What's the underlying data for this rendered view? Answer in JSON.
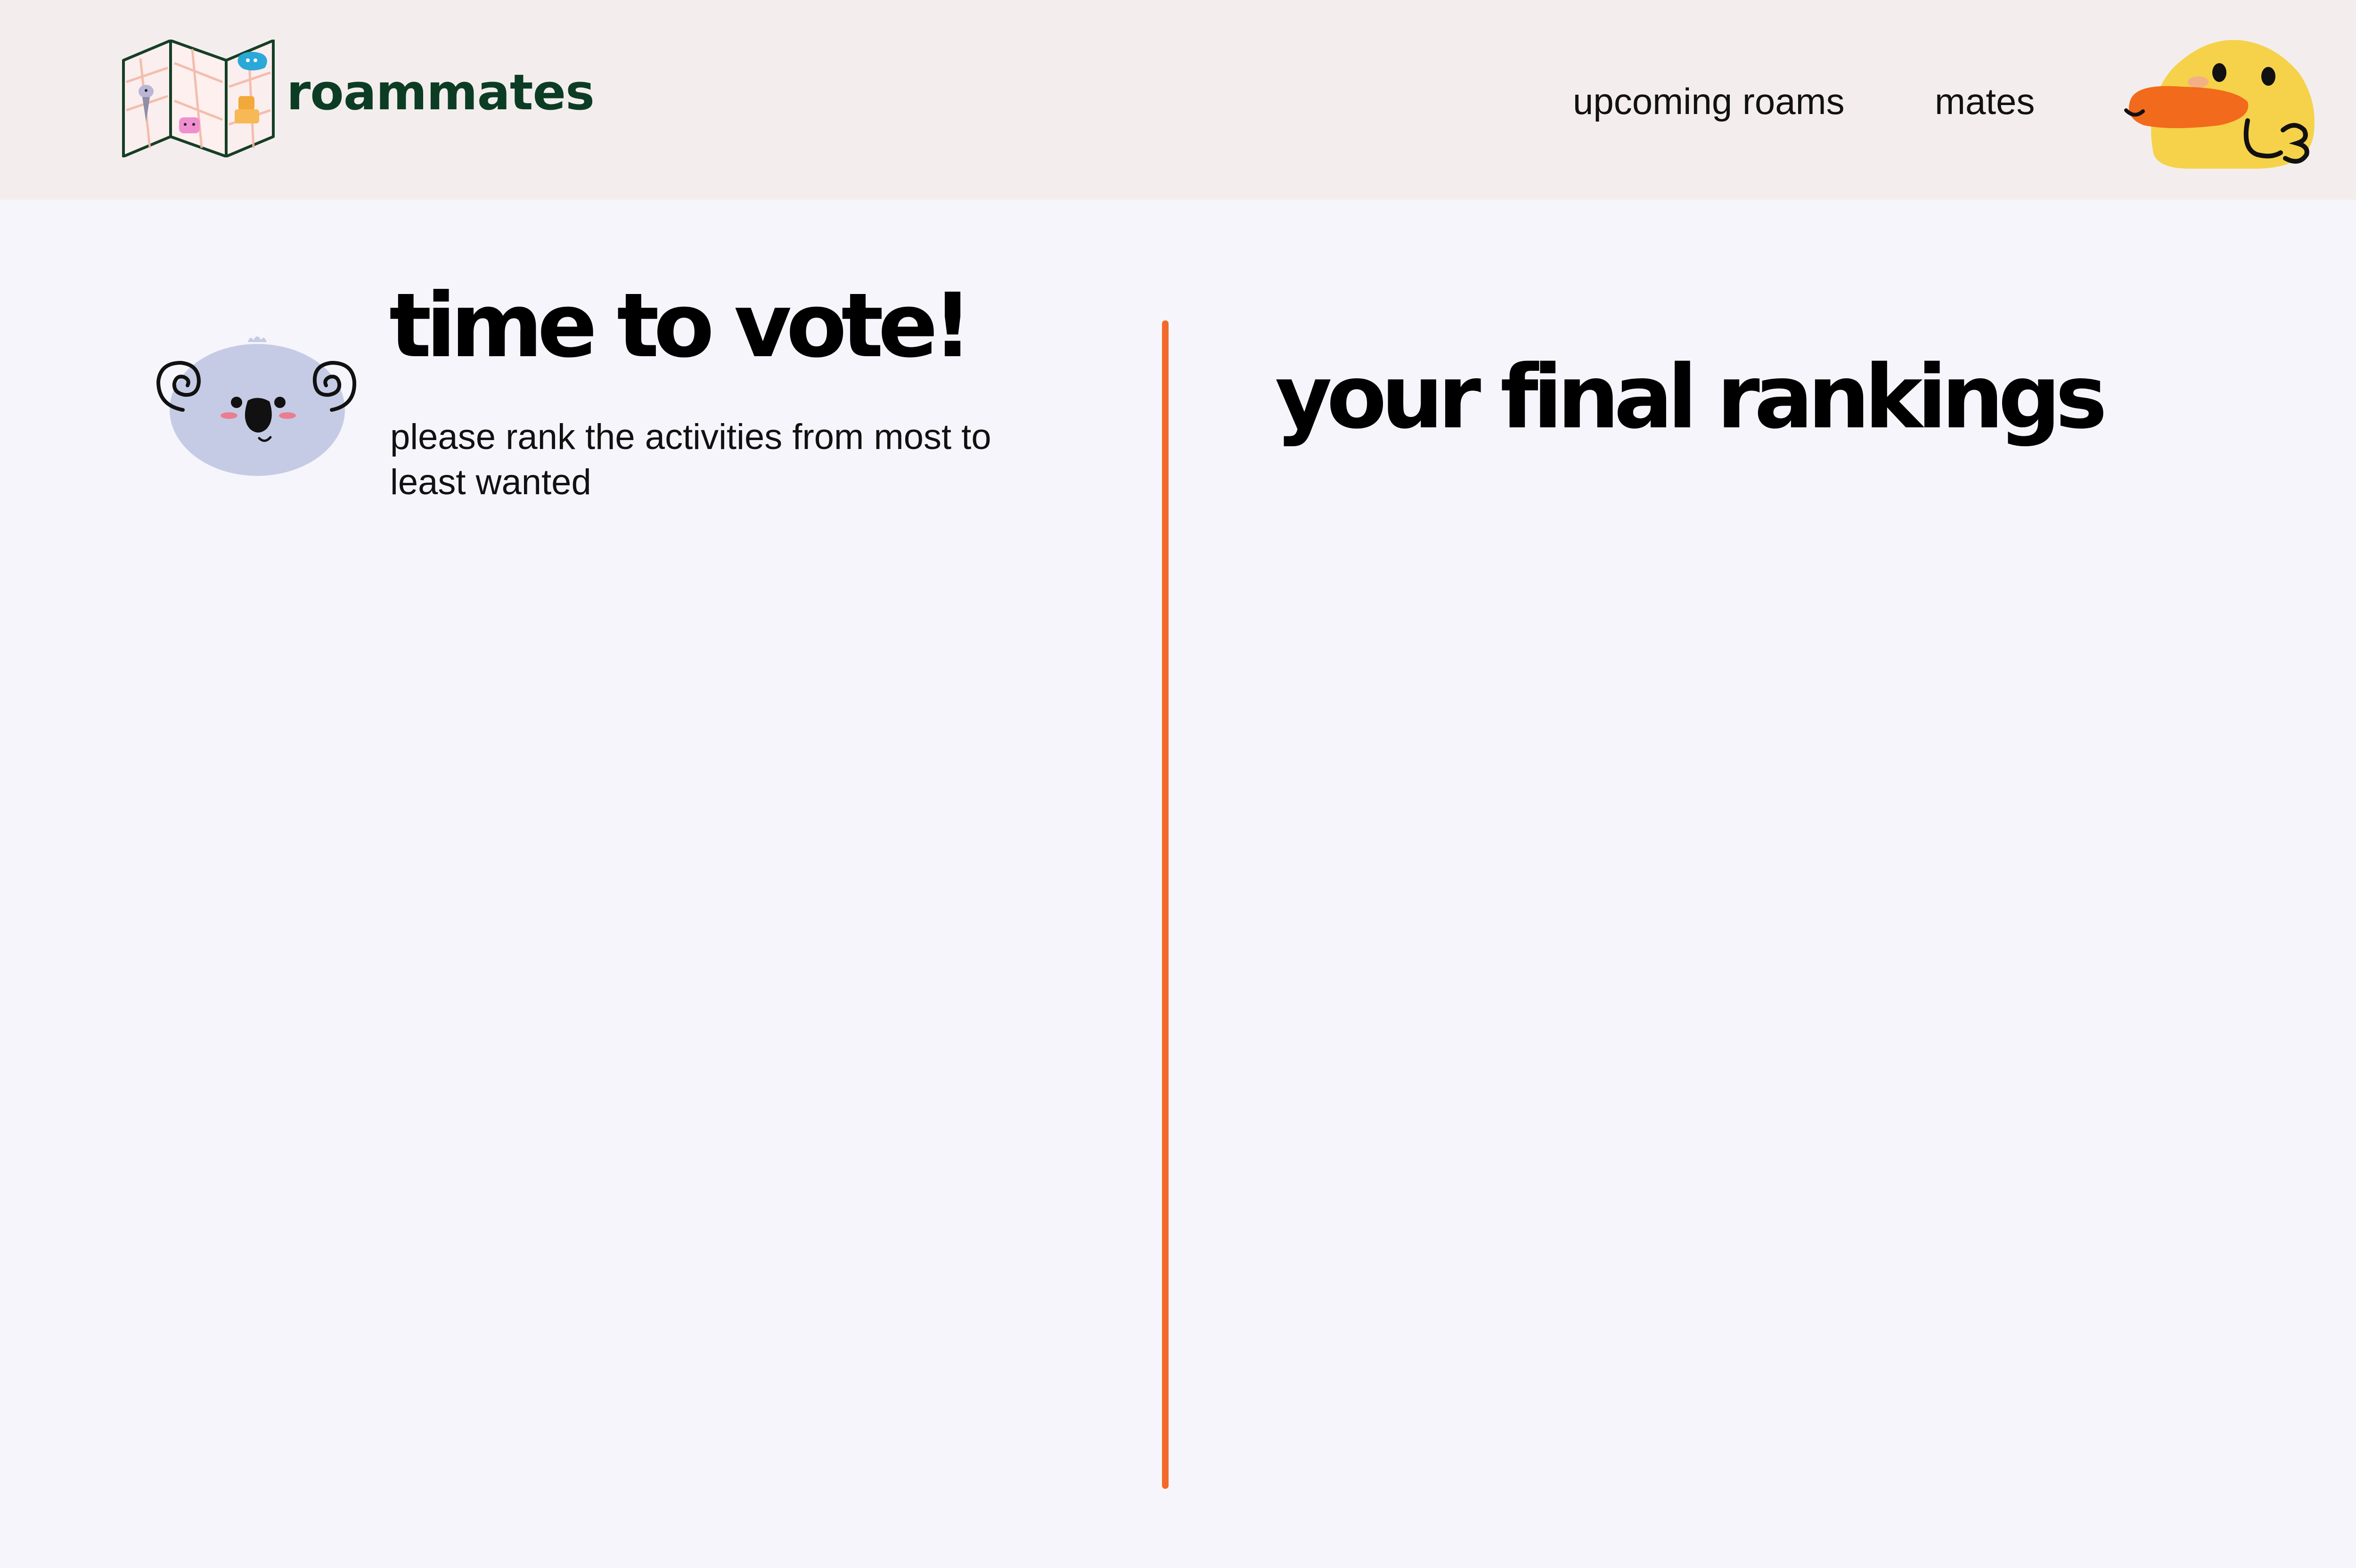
{
  "header": {
    "brand": "roammates",
    "nav": {
      "upcoming_roams": "upcoming roams",
      "mates": "mates"
    },
    "logo_icon": "folded-map-icon",
    "avatar_icon": "duck-avatar-icon"
  },
  "voting": {
    "title": "time to vote!",
    "subtitle": "please rank the activities from most to least wanted",
    "mascot_icon": "koala-icon"
  },
  "rankings": {
    "title": "your final rankings"
  },
  "colors": {
    "header_bg": "#f3eeed",
    "page_bg": "#f6f5fc",
    "brand_green": "#0c3d24",
    "divider_orange": "#f26a2a",
    "duck_yellow": "#f5d24a",
    "koala_lavender": "#c6cbe5"
  }
}
